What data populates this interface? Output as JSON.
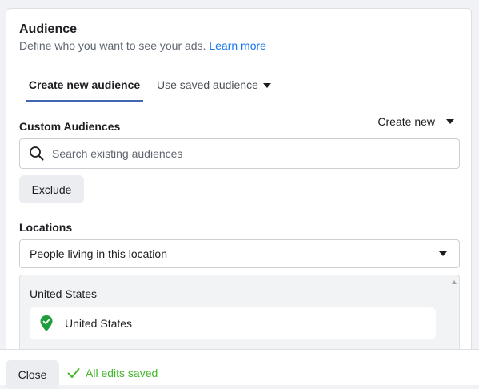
{
  "audience": {
    "title": "Audience",
    "subtitle": "Define who you want to see your ads.",
    "learn_more": "Learn more"
  },
  "tabs": [
    {
      "label": "Create new audience",
      "active": true
    },
    {
      "label": "Use saved audience",
      "active": false
    }
  ],
  "custom_audiences": {
    "label": "Custom Audiences",
    "create_new": "Create new",
    "search_placeholder": "Search existing audiences",
    "exclude_label": "Exclude"
  },
  "locations": {
    "label": "Locations",
    "selected_option": "People living in this location",
    "panel_heading": "United States",
    "items": [
      {
        "label": "United States"
      }
    ]
  },
  "footer": {
    "close_label": "Close",
    "status": "All edits saved"
  },
  "colors": {
    "accent": "#1877f2",
    "tab_underline": "#4267b2",
    "success": "#42b72a",
    "pin": "#1e9e3a"
  },
  "icons": {
    "search": "search-icon",
    "dropdown": "caret-down-icon",
    "location_pin": "location-pin-icon",
    "check": "check-icon"
  }
}
